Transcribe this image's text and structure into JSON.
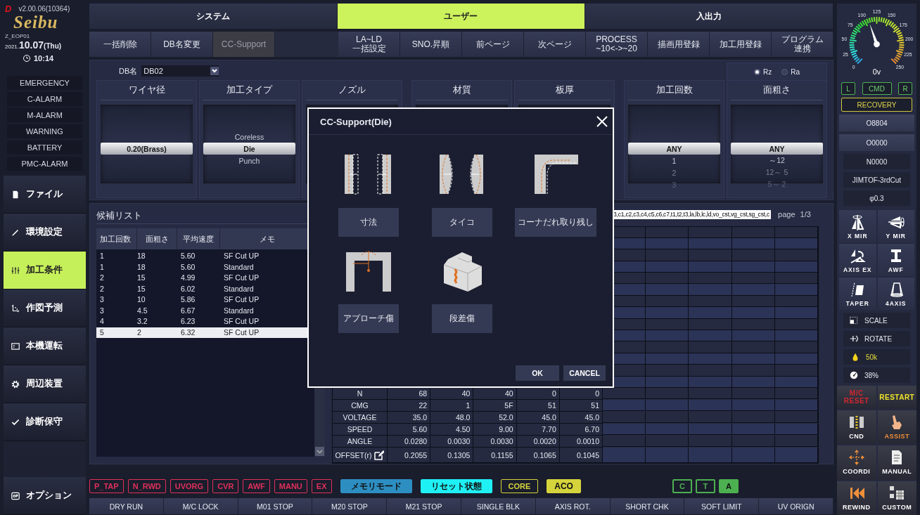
{
  "sidebar": {
    "badge": "D",
    "version": "v2.00.06(10364)",
    "logo": "Seibu",
    "machine": "Z_EOP01",
    "date_parts": [
      "2021.",
      "10.07",
      "(Thu)"
    ],
    "time": "10:14",
    "alarms": [
      "EMERGENCY",
      "C-ALARM",
      "M-ALARM",
      "WARNING",
      "BATTERY",
      "PMC-ALARM"
    ],
    "nav": [
      {
        "label": "ファイル",
        "selected": false
      },
      {
        "label": "環境設定",
        "selected": false
      },
      {
        "label": "加工条件",
        "selected": true
      },
      {
        "label": "作図予測",
        "selected": false
      },
      {
        "label": "本機運転",
        "selected": false
      },
      {
        "label": "周辺装置",
        "selected": false
      },
      {
        "label": "診断保守",
        "selected": false
      }
    ],
    "bottom_nav": {
      "label": "オプション",
      "selected": false
    }
  },
  "tabs": [
    {
      "label": "システム",
      "selected": false
    },
    {
      "label": "ユーザー",
      "selected": true
    },
    {
      "label": "入出力",
      "selected": false
    }
  ],
  "toolbar_left": [
    {
      "lines": [
        "一括削除"
      ],
      "selected": false
    },
    {
      "lines": [
        "DB名変更"
      ],
      "selected": false
    },
    {
      "lines": [
        "CC-Support"
      ],
      "selected": true
    }
  ],
  "toolbar_right": [
    {
      "lines": [
        "LA~LD",
        "一括設定"
      ],
      "selected": false
    },
    {
      "lines": [
        "SNO.昇順"
      ],
      "selected": false
    },
    {
      "lines": [
        "前ページ"
      ],
      "selected": false
    },
    {
      "lines": [
        "次ページ"
      ],
      "selected": false
    },
    {
      "lines": [
        "PROCESS",
        "~10<->~20"
      ],
      "selected": false
    },
    {
      "lines": [
        "描画用登録"
      ],
      "selected": false
    },
    {
      "lines": [
        "加工用登録"
      ],
      "selected": false
    },
    {
      "lines": [
        "プログラム",
        "連携"
      ],
      "selected": false
    }
  ],
  "conditions": {
    "db_label": "DB名",
    "db_value": "DB02",
    "units": [
      {
        "label": "Rz",
        "selected": true
      },
      {
        "label": "Ra",
        "selected": false
      }
    ],
    "columns": [
      {
        "title": "ワイヤ径",
        "options": [
          {
            "label": "0.20(Brass)",
            "selected": true
          }
        ]
      },
      {
        "title": "加工タイプ",
        "options": [
          {
            "label": "Coreless",
            "selected": false
          },
          {
            "label": "Die",
            "selected": true
          },
          {
            "label": "Punch",
            "selected": false
          }
        ]
      },
      {
        "title": "ノズル"
      },
      {
        "title": "材質"
      },
      {
        "title": "板厚"
      },
      {
        "title": "加工回数",
        "options": [
          {
            "label": "ANY",
            "selected": true
          },
          {
            "label": "1",
            "selected": false
          },
          {
            "label": "2",
            "selected": false
          },
          {
            "label": "3",
            "selected": false
          }
        ]
      },
      {
        "title": "面粗さ",
        "options": [
          {
            "label": "ANY",
            "selected": true
          },
          {
            "label": "～12",
            "selected": false
          },
          {
            "label": "12～ 5",
            "selected": false
          },
          {
            "label": "5～ 2",
            "selected": false
          }
        ]
      }
    ]
  },
  "candidates": {
    "title": "候補リスト",
    "columns": [
      "加工回数",
      "面粗さ",
      "平均速度",
      "メモ"
    ],
    "rows": [
      {
        "cells": [
          "1",
          "18",
          "5.60",
          "SF Cut UP"
        ],
        "selected": false
      },
      {
        "cells": [
          "1",
          "18",
          "5.60",
          "Standard"
        ],
        "selected": false
      },
      {
        "cells": [
          "2",
          "15",
          "4.99",
          "SF Cut UP"
        ],
        "selected": false
      },
      {
        "cells": [
          "2",
          "15",
          "6.02",
          "Standard"
        ],
        "selected": false
      },
      {
        "cells": [
          "3",
          "10",
          "5.86",
          "SF Cut UP"
        ],
        "selected": false
      },
      {
        "cells": [
          "3",
          "4.5",
          "6.67",
          "Standard"
        ],
        "selected": false
      },
      {
        "cells": [
          "4",
          "3.2",
          "6.23",
          "SF Cut UP"
        ],
        "selected": false
      },
      {
        "cells": [
          "5",
          "2",
          "6.32",
          "SF Cut UP"
        ],
        "selected": true
      }
    ]
  },
  "parameters": {
    "filter": "3,c1,c2,c3,c4,c5,c6,c7,t1,t2,t3,la,lb,lc,ld,vo_cst,vg_cst,sg_cst,c",
    "page_label": "page",
    "page": "1/3",
    "rows": [
      {
        "label": "N",
        "values": [
          "68",
          "40",
          "40",
          "0",
          "0"
        ],
        "editable": false
      },
      {
        "label": "CMG",
        "values": [
          "22",
          "1",
          "5F",
          "51",
          "51"
        ],
        "editable": false
      },
      {
        "label": "VOLTAGE",
        "values": [
          "35.0",
          "48.0",
          "52.0",
          "45.0",
          "45.0"
        ],
        "editable": false
      },
      {
        "label": "SPEED",
        "values": [
          "5.60",
          "4.50",
          "9.00",
          "7.70",
          "6.70"
        ],
        "editable": false
      },
      {
        "label": "ANGLE",
        "values": [
          "0.0280",
          "0.0030",
          "0.0030",
          "0.0020",
          "0.0010"
        ],
        "editable": false
      },
      {
        "label": "OFFSET(r)",
        "values": [
          "0.2055",
          "0.1305",
          "0.1155",
          "0.1065",
          "0.1045"
        ],
        "editable": true
      }
    ]
  },
  "dialog": {
    "title": "CC-Support(Die)",
    "items": [
      "寸法",
      "タイコ",
      "コーナだれ取り残し",
      "アプローチ傷",
      "段差傷"
    ],
    "buttons": [
      "OK",
      "CANCEL"
    ]
  },
  "status_tags": [
    {
      "label": "P_TAP",
      "color": "#e0305a",
      "filled": false
    },
    {
      "label": "N_RWD",
      "color": "#e0305a",
      "filled": false
    },
    {
      "label": "UVORG",
      "color": "#e0305a",
      "filled": false
    },
    {
      "label": "CVR",
      "color": "#e0305a",
      "filled": false
    },
    {
      "label": "AWF",
      "color": "#e0305a",
      "filled": false
    },
    {
      "label": "MANU",
      "color": "#e0305a",
      "filled": false
    },
    {
      "label": "EX",
      "color": "#e0305a",
      "filled": false
    },
    {
      "label": "メモリモード",
      "color": "#2d8ec2",
      "filled": true
    },
    {
      "label": "リセット状態",
      "color": "#1ff0f4",
      "filled": true
    },
    {
      "label": "CORE",
      "color": "#d6d43c",
      "filled": false
    },
    {
      "label": "ACO",
      "color": "#d6d43c",
      "filled": true
    }
  ],
  "mode_tags": [
    {
      "label": "C",
      "color": "#4cb050",
      "filled": false
    },
    {
      "label": "T",
      "color": "#4cb050",
      "filled": false
    },
    {
      "label": "A",
      "color": "#4cb050",
      "filled": true
    }
  ],
  "functions": [
    "DRY RUN",
    "M/C LOCK",
    "M01 STOP",
    "M20 STOP",
    "M21 STOP",
    "SINGLE BLK",
    "AXIS ROT.",
    "SHORT CHK",
    "SOFT LIMIT",
    "UV ORIGN"
  ],
  "right": {
    "gauge": {
      "labels": [
        "0",
        "25",
        "50",
        "75",
        "100",
        "125",
        "150",
        "175",
        "200",
        "225",
        "250"
      ],
      "reading": "0v"
    },
    "sides": [
      "L",
      "CMD",
      "R"
    ],
    "recovery": "RECOVERY",
    "programs": [
      {
        "label": "O8804",
        "kind": "button"
      },
      {
        "label": "O0000",
        "kind": "button"
      },
      {
        "label": "N0000",
        "kind": "display"
      },
      {
        "label": "JIMTOF-3rdCut",
        "kind": "display"
      },
      {
        "label": "φ0.3",
        "kind": "display"
      }
    ],
    "tools": [
      "X MIR",
      "Y MIR",
      "AXIS EX",
      "AWF",
      "TAPER",
      "4AXIS"
    ],
    "settings": [
      {
        "label": "SCALE",
        "kind": "normal"
      },
      {
        "label": "ROTATE",
        "kind": "normal"
      },
      {
        "label": "50k",
        "kind": "highlight"
      },
      {
        "label": "38%",
        "kind": "normal"
      }
    ],
    "actions": [
      {
        "label": "M/C RESET",
        "color": "#d2262e"
      },
      {
        "label": "RESTART",
        "color": "#f0e42a"
      },
      {
        "label": "CND",
        "color": "#ffffff"
      },
      {
        "label": "ASSIST",
        "color": "#f0903a"
      },
      {
        "label": "COORDI",
        "color": "#ffffff"
      },
      {
        "label": "MANUAL",
        "color": "#ffffff"
      },
      {
        "label": "REWIND",
        "color": "#ffffff"
      },
      {
        "label": "CUSTOM",
        "color": "#ffffff"
      }
    ]
  }
}
